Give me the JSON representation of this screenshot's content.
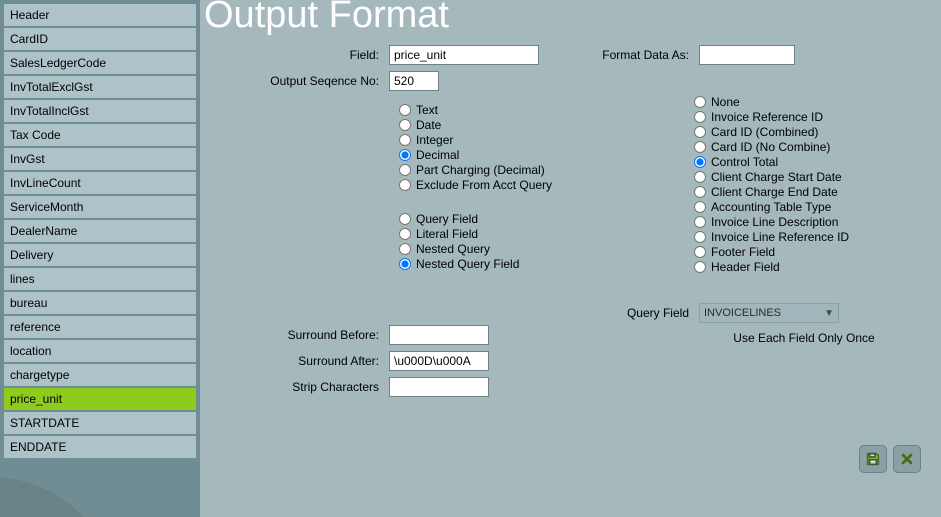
{
  "page_title": "Output Format",
  "sidebar": {
    "items": [
      {
        "label": "Header"
      },
      {
        "label": "CardID"
      },
      {
        "label": "SalesLedgerCode"
      },
      {
        "label": "InvTotalExclGst"
      },
      {
        "label": "InvTotalInclGst"
      },
      {
        "label": "Tax Code"
      },
      {
        "label": "InvGst"
      },
      {
        "label": "InvLineCount"
      },
      {
        "label": "ServiceMonth"
      },
      {
        "label": "DealerName"
      },
      {
        "label": "Delivery"
      },
      {
        "label": "lines"
      },
      {
        "label": "bureau"
      },
      {
        "label": "reference"
      },
      {
        "label": "location"
      },
      {
        "label": "chargetype"
      },
      {
        "label": "price_unit"
      },
      {
        "label": "STARTDATE"
      },
      {
        "label": "ENDDATE"
      }
    ],
    "selected_index": 16
  },
  "form": {
    "field_label": "Field:",
    "field_value": "price_unit",
    "seq_label": "Output Seqence No:",
    "seq_value": "520",
    "type_options": [
      "Text",
      "Date",
      "Integer",
      "Decimal",
      "Part Charging (Decimal)",
      "Exclude From Acct Query"
    ],
    "type_selected": "Decimal",
    "source_options": [
      "Query Field",
      "Literal Field",
      "Nested Query",
      "Nested Query Field"
    ],
    "source_selected": "Nested Query Field",
    "surround_before_label": "Surround Before:",
    "surround_before_value": "",
    "surround_after_label": "Surround After:",
    "surround_after_value": "\\u000D\\u000A",
    "strip_label": "Strip Characters",
    "strip_value": "",
    "format_as_label": "Format Data As:",
    "format_as_value": "",
    "special_options": [
      "None",
      "Invoice Reference ID",
      "Card ID (Combined)",
      "Card ID (No Combine)",
      "Control Total",
      "Client Charge Start Date",
      "Client Charge End Date",
      "Accounting Table Type",
      "Invoice Line Description",
      "Invoice Line Reference ID",
      "Footer Field",
      "Header Field"
    ],
    "special_selected": "Control Total",
    "query_field_label": "Query Field",
    "query_field_value": "INVOICELINES",
    "use_once_label": "Use Each Field Only Once"
  }
}
